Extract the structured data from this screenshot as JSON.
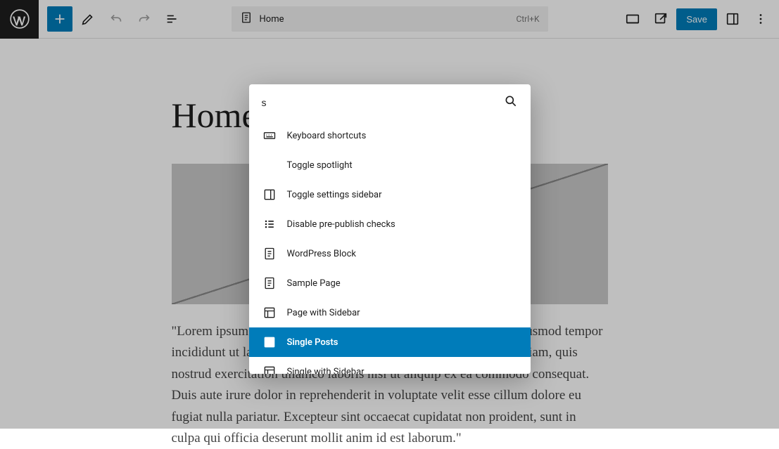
{
  "toolbar": {
    "doc_title": "Home",
    "shortcut": "Ctrl+K",
    "save_label": "Save"
  },
  "page": {
    "title": "Home",
    "body": "\"Lorem ipsum dolor sit amet, consectetur adipiscing elit, sed do eiusmod tempor incididunt ut labore et dolore magna aliqua. Ut enim ad minim veniam, quis nostrud exercitation ullamco laboris nisi ut aliquip ex ea commodo consequat. Duis aute irure dolor in reprehenderit in voluptate velit esse cillum dolore eu fugiat nulla pariatur. Excepteur sint occaecat cupidatat non proident, sunt in culpa qui officia deserunt mollit anim id est laborum.\""
  },
  "palette": {
    "query": "s",
    "items": [
      {
        "label": "Keyboard shortcuts",
        "icon": "keyboard"
      },
      {
        "label": "Toggle spotlight",
        "icon": ""
      },
      {
        "label": "Toggle settings sidebar",
        "icon": "sidebar"
      },
      {
        "label": "Disable pre-publish checks",
        "icon": "checklist"
      },
      {
        "label": "WordPress Block",
        "icon": "page"
      },
      {
        "label": "Sample Page",
        "icon": "page"
      },
      {
        "label": "Page with Sidebar",
        "icon": "layout"
      },
      {
        "label": "Single Posts",
        "icon": "layout",
        "selected": true
      },
      {
        "label": "Single with Sidebar",
        "icon": "layout"
      }
    ]
  }
}
